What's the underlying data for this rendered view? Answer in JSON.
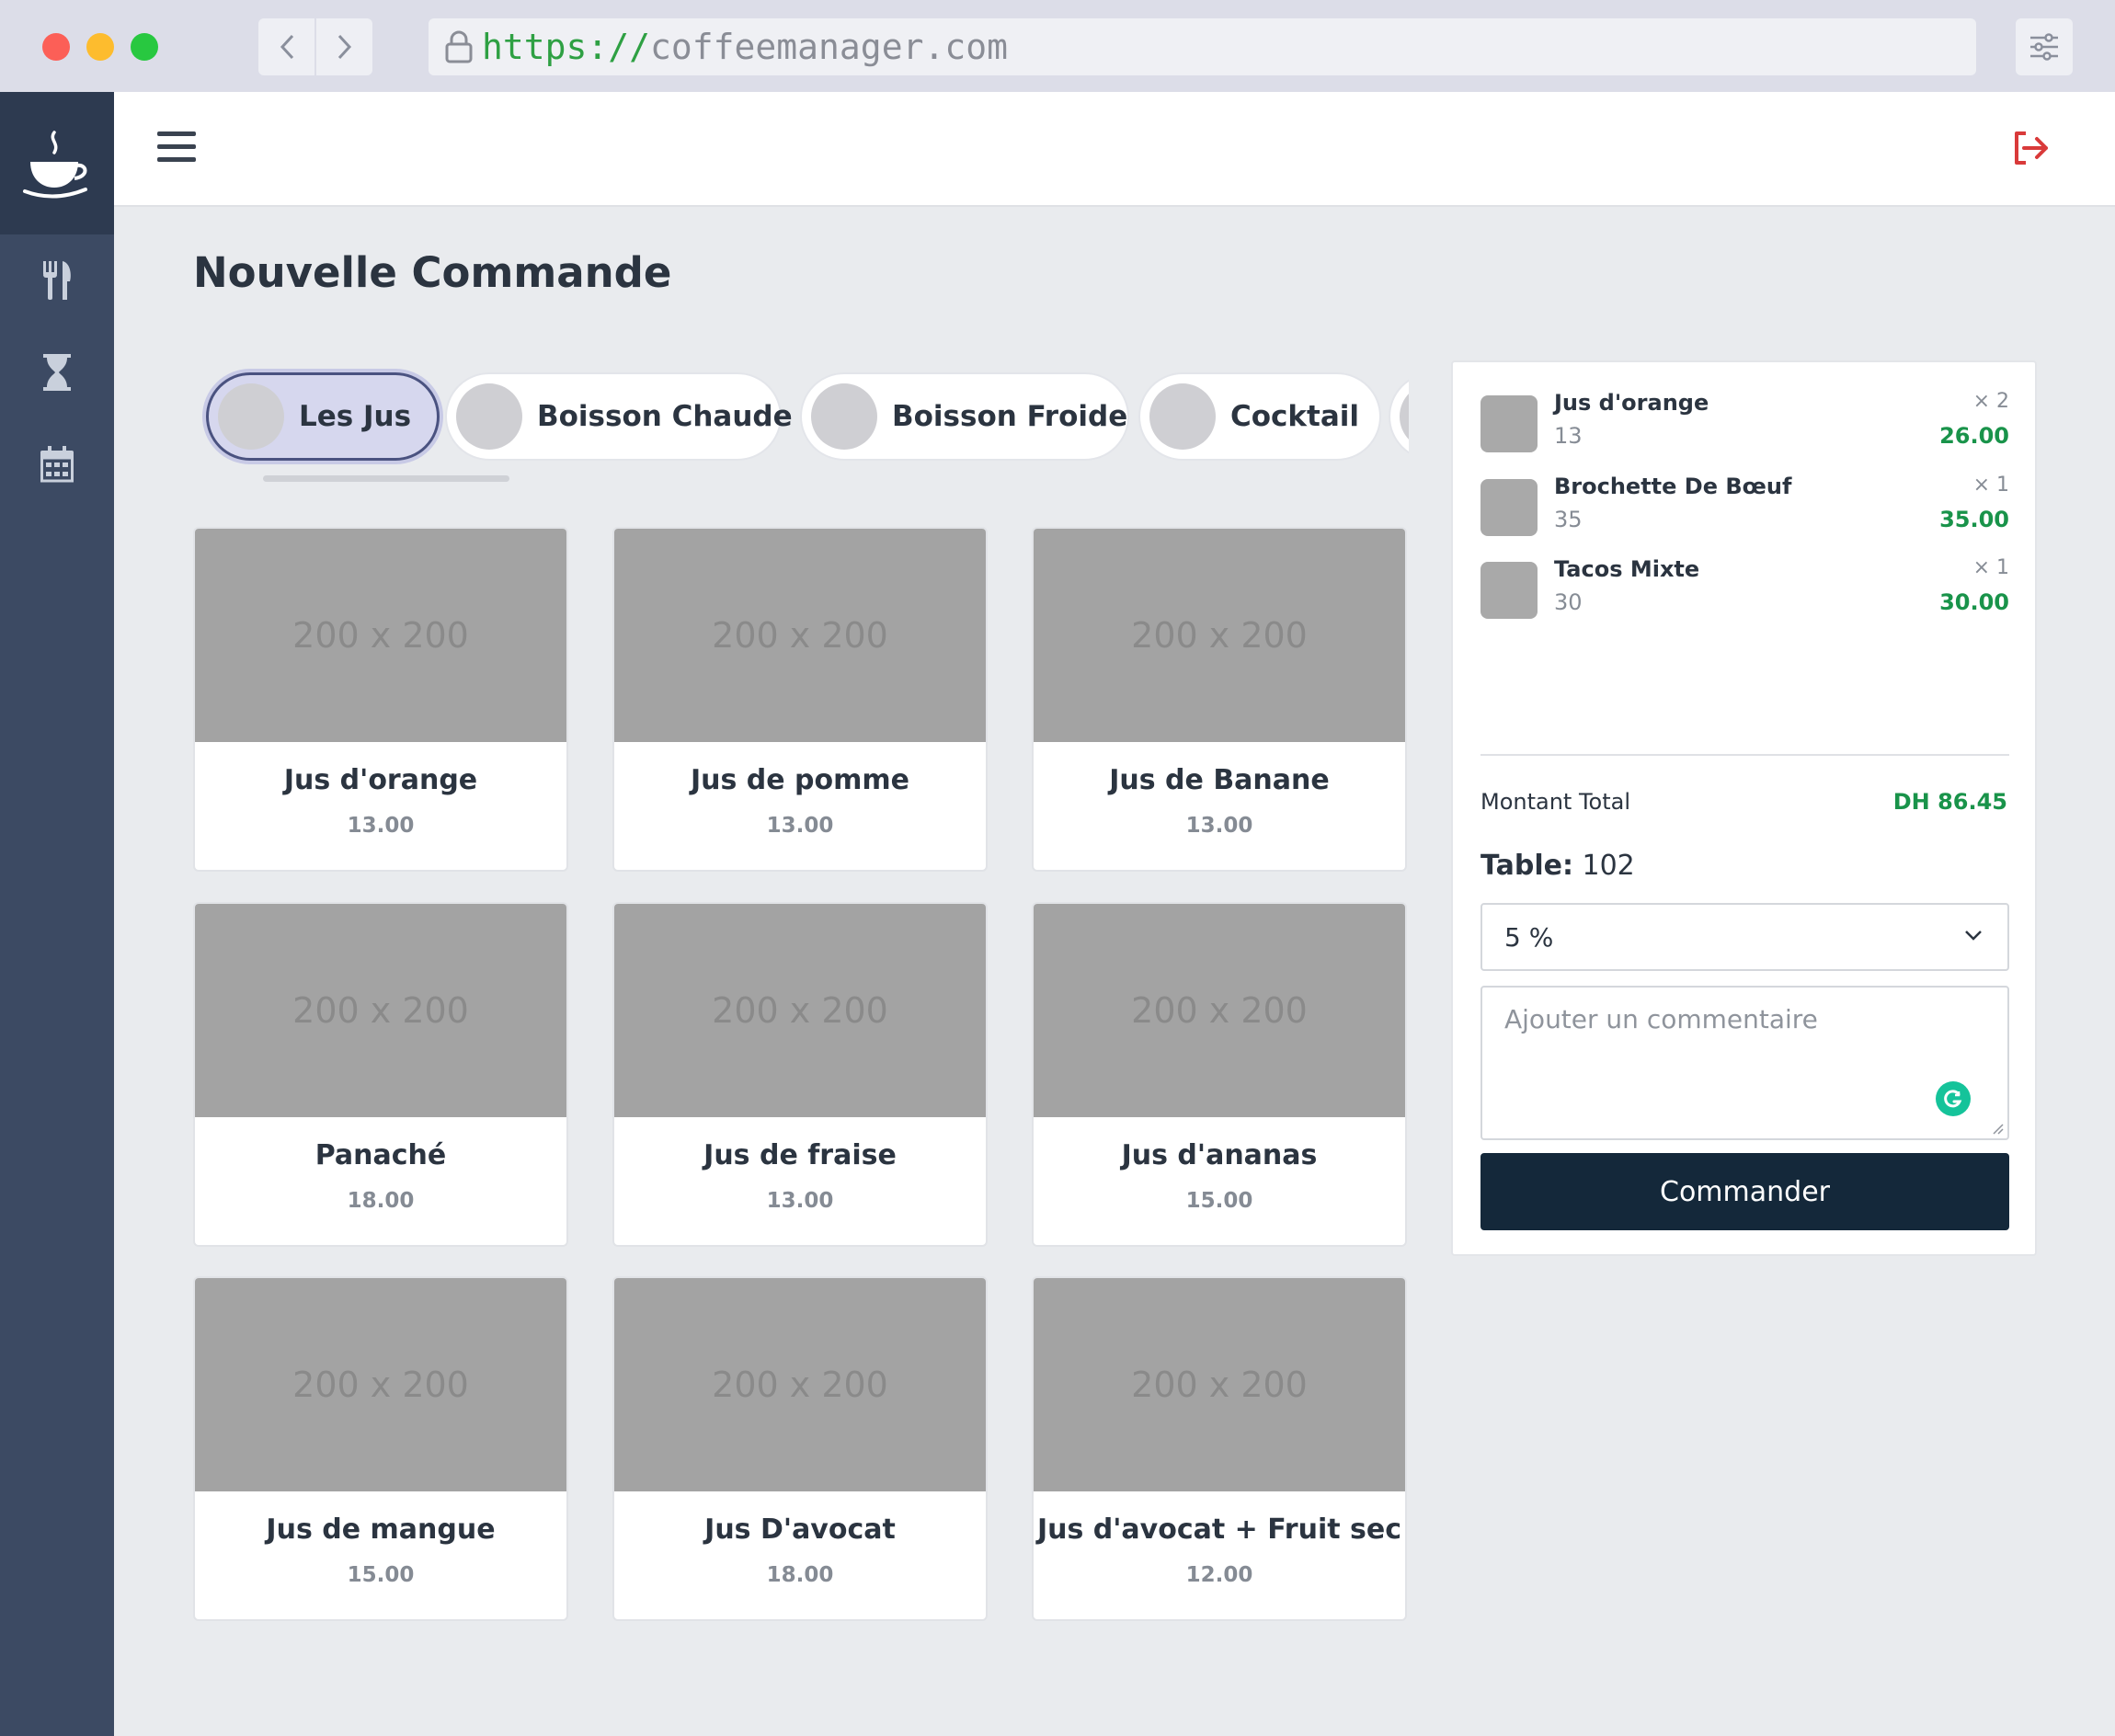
{
  "browser": {
    "url_scheme": "https://",
    "url_host": "coffeemanager.com"
  },
  "sidebar": {
    "logo_icon": "coffee-cup-icon",
    "items": [
      {
        "icon": "utensils-icon"
      },
      {
        "icon": "hourglass-icon"
      },
      {
        "icon": "calendar-icon"
      }
    ]
  },
  "topbar": {
    "menu_icon": "hamburger-icon",
    "logout_icon": "logout-icon",
    "logout_color": "#d93a3a"
  },
  "page": {
    "title": "Nouvelle Commande"
  },
  "categories": [
    {
      "label": "Les Jus",
      "active": true
    },
    {
      "label": "Boisson Chaude",
      "active": false
    },
    {
      "label": "Boisson Froide",
      "active": false
    },
    {
      "label": "Cocktail",
      "active": false
    }
  ],
  "products": [
    {
      "image_text": "200 x 200",
      "name": "Jus d'orange",
      "price": "13.00"
    },
    {
      "image_text": "200 x 200",
      "name": "Jus de pomme",
      "price": "13.00"
    },
    {
      "image_text": "200 x 200",
      "name": "Jus de Banane",
      "price": "13.00"
    },
    {
      "image_text": "200 x 200",
      "name": "Panaché",
      "price": "18.00"
    },
    {
      "image_text": "200 x 200",
      "name": "Jus de fraise",
      "price": "13.00"
    },
    {
      "image_text": "200 x 200",
      "name": "Jus d'ananas",
      "price": "15.00"
    },
    {
      "image_text": "200 x 200",
      "name": "Jus de mangue",
      "price": "15.00"
    },
    {
      "image_text": "200 x 200",
      "name": "Jus D'avocat",
      "price": "18.00"
    },
    {
      "image_text": "200 x 200",
      "name": "Jus d'avocat + Fruit sec",
      "price": "12.00"
    }
  ],
  "order": {
    "items": [
      {
        "name": "Jus d'orange",
        "unit_price": "13",
        "qty": "× 2",
        "total": "26.00"
      },
      {
        "name": "Brochette De Bœuf",
        "unit_price": "35",
        "qty": "× 1",
        "total": "35.00"
      },
      {
        "name": "Tacos Mixte",
        "unit_price": "30",
        "qty": "× 1",
        "total": "30.00"
      }
    ],
    "total_label": "Montant Total",
    "total_value": "DH 86.45",
    "table_label": "Table:",
    "table_value": "102",
    "discount_selected": "5 %",
    "comment_placeholder": "Ajouter un commentaire",
    "submit_label": "Commander",
    "accent_green": "#19934a",
    "button_color": "#14283a"
  }
}
